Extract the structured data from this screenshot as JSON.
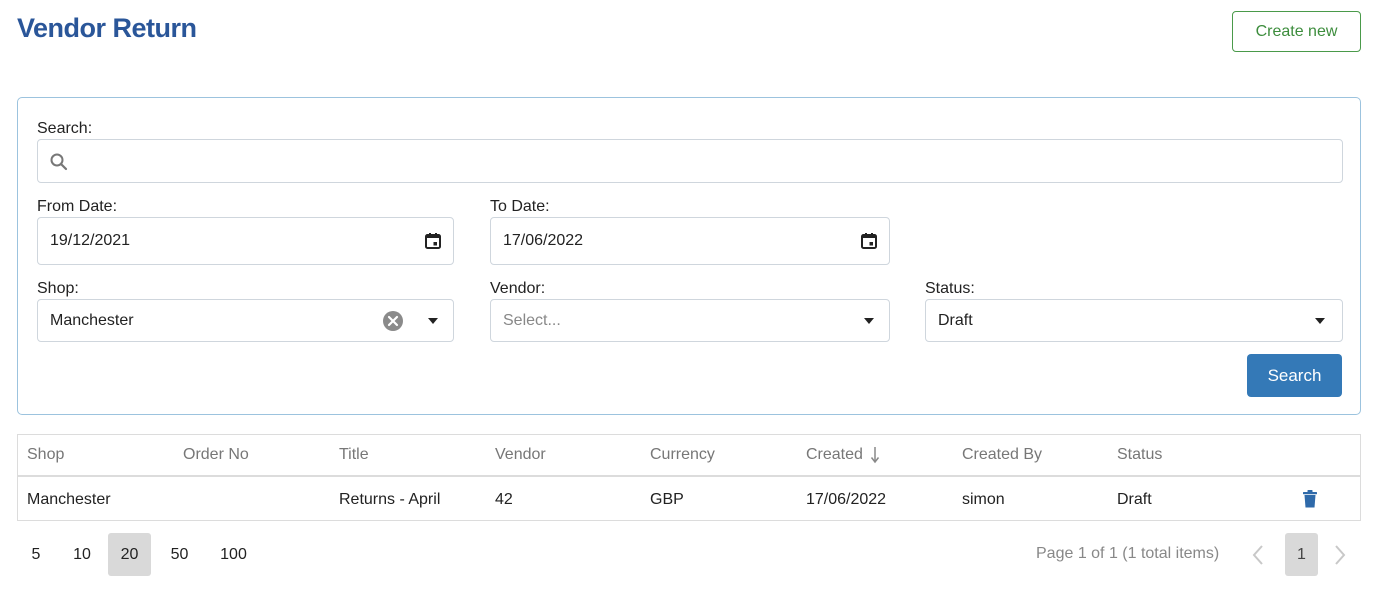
{
  "header": {
    "title": "Vendor Return",
    "create_label": "Create new"
  },
  "filters": {
    "search_label": "Search:",
    "search_value": "",
    "from_label": "From Date:",
    "from_value": "19/12/2021",
    "to_label": "To Date:",
    "to_value": "17/06/2022",
    "shop_label": "Shop:",
    "shop_value": "Manchester",
    "vendor_label": "Vendor:",
    "vendor_placeholder": "Select...",
    "status_label": "Status:",
    "status_value": "Draft",
    "search_button": "Search"
  },
  "table": {
    "columns": [
      "Shop",
      "Order No",
      "Title",
      "Vendor",
      "Currency",
      "Created",
      "Created By",
      "Status"
    ],
    "sort_column": "Created",
    "sort_direction": "descending",
    "rows": [
      {
        "shop": "Manchester",
        "order_no": "",
        "title": "Returns - April",
        "vendor": "42",
        "currency": "GBP",
        "created": "17/06/2022",
        "created_by": "simon",
        "status": "Draft"
      }
    ]
  },
  "pager": {
    "sizes": [
      "5",
      "10",
      "20",
      "50",
      "100"
    ],
    "active_size": "20",
    "info": "Page 1 of 1 (1 total items)",
    "current_page": "1"
  },
  "colors": {
    "title": "#2a5699",
    "primary": "#3479b7",
    "create": "#3d8d3d",
    "panel_border": "#9cc3de",
    "delete_icon": "#2f6aaa"
  }
}
